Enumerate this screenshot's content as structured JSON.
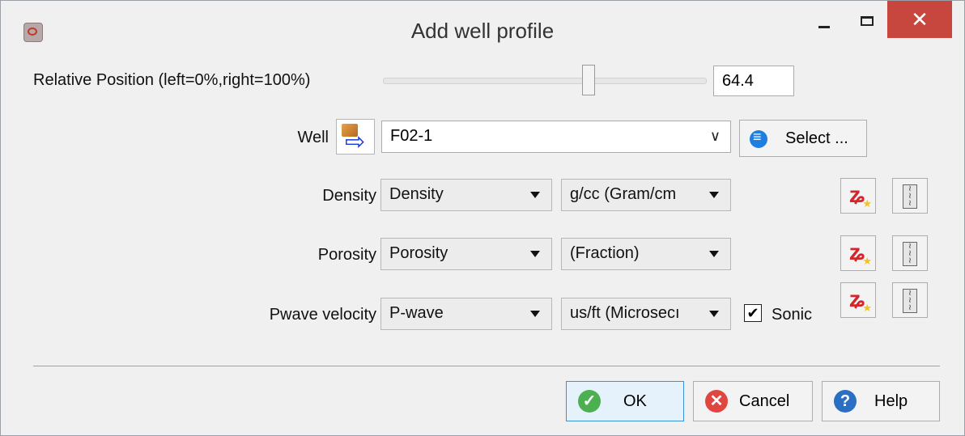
{
  "window": {
    "title": "Add well profile",
    "minimize_glyph": "–",
    "maximize_glyph": "□",
    "close_glyph": "✕"
  },
  "position": {
    "label": "Relative Position (left=0%,right=100%)",
    "value": "64.4",
    "slider_fraction": 0.644
  },
  "well": {
    "label": "Well",
    "value": "F02-1",
    "select_label": "Select ..."
  },
  "rows": [
    {
      "label": "Density",
      "log": "Density",
      "unit": "g/cc (Gram/cm"
    },
    {
      "label": "Porosity",
      "log": "Porosity",
      "unit": "(Fraction)"
    },
    {
      "label": "Pwave velocity",
      "log": "P-wave",
      "unit": "us/ft (Microsecı",
      "sonic_label": "Sonic",
      "sonic_checked": true
    }
  ],
  "buttons": {
    "ok": "OK",
    "cancel": "Cancel",
    "help": "Help"
  },
  "colors": {
    "accent": "#3b8ed8",
    "close": "#c7463e",
    "ok_icon": "#4caf50",
    "cancel_icon": "#e0453f",
    "help_icon": "#2b6fc4"
  },
  "icons": [
    "app-icon",
    "well-load-icon",
    "list-icon",
    "create-log-icon",
    "log-tool-icon",
    "check-icon",
    "cancel-icon",
    "help-icon"
  ]
}
